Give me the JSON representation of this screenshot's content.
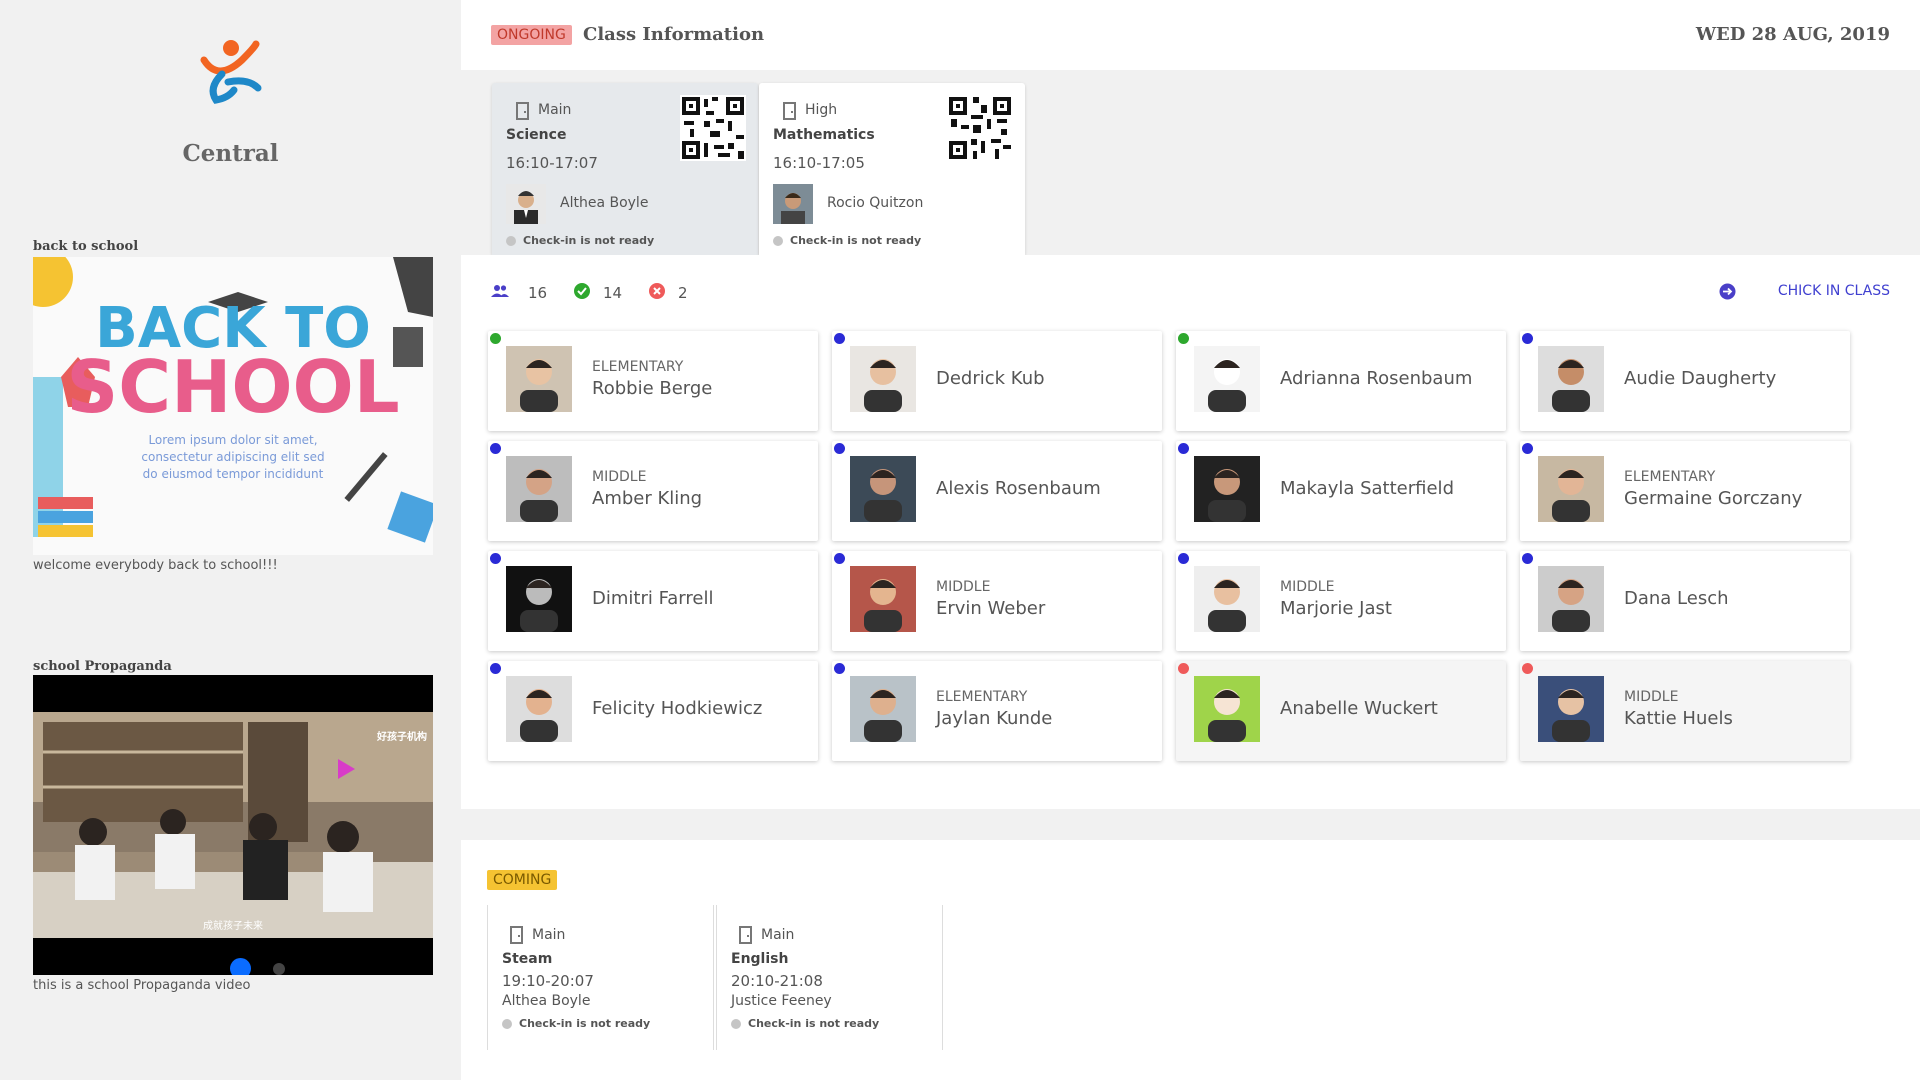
{
  "sidebar": {
    "school_name": "Central",
    "poster_panel": {
      "title": "back to school",
      "poster_line1": "BACK TO",
      "poster_line2": "SCHOOL",
      "poster_text": "Lorem ipsum dolor sit amet, consectetur adipiscing elit sed do eiusmod tempor incididunt",
      "caption": "welcome everybody back to school!!!"
    },
    "video_panel": {
      "title": "school Propaganda",
      "subtitle": "成就孩子未来",
      "brand": "好孩子机构",
      "caption": "this is a school Propaganda video"
    }
  },
  "header": {
    "status_badge": "ONGOING",
    "title": "Class Information",
    "date": "WED 28 AUG,  2019"
  },
  "current_classes": [
    {
      "room": "Main",
      "subject": "Science",
      "time": "16:10-17:07",
      "teacher": "Althea Boyle",
      "status": "Check-in is not ready"
    },
    {
      "room": "High",
      "subject": "Mathematics",
      "time": "16:10-17:05",
      "teacher": "Rocio Quitzon",
      "status": "Check-in is not ready"
    }
  ],
  "stats": {
    "total": "16",
    "present": "14",
    "absent": "2"
  },
  "checkin_label": "CHICK IN CLASS",
  "students": [
    {
      "level": "ELEMENTARY",
      "name": "Robbie Berge",
      "status": "green"
    },
    {
      "level": "",
      "name": "Dedrick Kub",
      "status": "blue"
    },
    {
      "level": "",
      "name": "Adrianna Rosenbaum",
      "status": "green"
    },
    {
      "level": "",
      "name": "Audie Daugherty",
      "status": "blue"
    },
    {
      "level": "MIDDLE",
      "name": "Amber Kling",
      "status": "blue"
    },
    {
      "level": "",
      "name": "Alexis Rosenbaum",
      "status": "blue"
    },
    {
      "level": "",
      "name": "Makayla Satterfield",
      "status": "blue"
    },
    {
      "level": "ELEMENTARY",
      "name": "Germaine Gorczany",
      "status": "blue"
    },
    {
      "level": "",
      "name": "Dimitri Farrell",
      "status": "blue"
    },
    {
      "level": "MIDDLE",
      "name": "Ervin Weber",
      "status": "blue"
    },
    {
      "level": "MIDDLE",
      "name": "Marjorie Jast",
      "status": "blue"
    },
    {
      "level": "",
      "name": "Dana Lesch",
      "status": "blue"
    },
    {
      "level": "",
      "name": "Felicity Hodkiewicz",
      "status": "blue"
    },
    {
      "level": "ELEMENTARY",
      "name": "Jaylan Kunde",
      "status": "blue"
    },
    {
      "level": "",
      "name": "Anabelle Wuckert",
      "status": "red"
    },
    {
      "level": "MIDDLE",
      "name": "Kattie Huels",
      "status": "red"
    }
  ],
  "coming": {
    "badge": "COMING",
    "classes": [
      {
        "room": "Main",
        "subject": "Steam",
        "time": "19:10-20:07",
        "teacher": "Althea Boyle",
        "status": "Check-in is not ready"
      },
      {
        "room": "Main",
        "subject": "English",
        "time": "20:10-21:08",
        "teacher": "Justice Feeney",
        "status": "Check-in is not ready"
      }
    ]
  },
  "colors": {
    "present": "#2ea82e",
    "checked": "#2a2ad6",
    "absent": "#ef5a5a",
    "ongoing_badge": "#f3a3a3",
    "coming_badge": "#f5c332",
    "accent": "#4040d0"
  }
}
